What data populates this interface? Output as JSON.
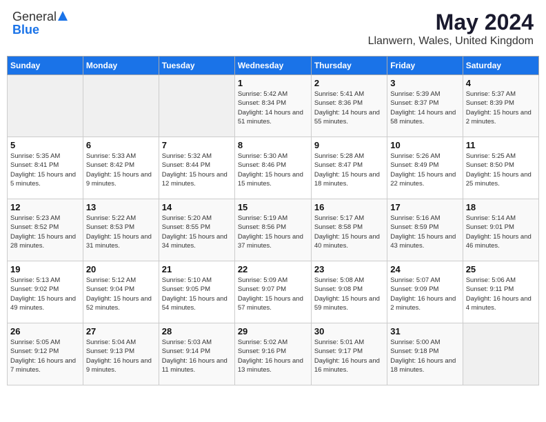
{
  "logo": {
    "general": "General",
    "blue": "Blue"
  },
  "title": {
    "month": "May 2024",
    "location": "Llanwern, Wales, United Kingdom"
  },
  "days_of_week": [
    "Sunday",
    "Monday",
    "Tuesday",
    "Wednesday",
    "Thursday",
    "Friday",
    "Saturday"
  ],
  "weeks": [
    [
      {
        "day": "",
        "info": ""
      },
      {
        "day": "",
        "info": ""
      },
      {
        "day": "",
        "info": ""
      },
      {
        "day": "1",
        "info": "Sunrise: 5:42 AM\nSunset: 8:34 PM\nDaylight: 14 hours and 51 minutes."
      },
      {
        "day": "2",
        "info": "Sunrise: 5:41 AM\nSunset: 8:36 PM\nDaylight: 14 hours and 55 minutes."
      },
      {
        "day": "3",
        "info": "Sunrise: 5:39 AM\nSunset: 8:37 PM\nDaylight: 14 hours and 58 minutes."
      },
      {
        "day": "4",
        "info": "Sunrise: 5:37 AM\nSunset: 8:39 PM\nDaylight: 15 hours and 2 minutes."
      }
    ],
    [
      {
        "day": "5",
        "info": "Sunrise: 5:35 AM\nSunset: 8:41 PM\nDaylight: 15 hours and 5 minutes."
      },
      {
        "day": "6",
        "info": "Sunrise: 5:33 AM\nSunset: 8:42 PM\nDaylight: 15 hours and 9 minutes."
      },
      {
        "day": "7",
        "info": "Sunrise: 5:32 AM\nSunset: 8:44 PM\nDaylight: 15 hours and 12 minutes."
      },
      {
        "day": "8",
        "info": "Sunrise: 5:30 AM\nSunset: 8:46 PM\nDaylight: 15 hours and 15 minutes."
      },
      {
        "day": "9",
        "info": "Sunrise: 5:28 AM\nSunset: 8:47 PM\nDaylight: 15 hours and 18 minutes."
      },
      {
        "day": "10",
        "info": "Sunrise: 5:26 AM\nSunset: 8:49 PM\nDaylight: 15 hours and 22 minutes."
      },
      {
        "day": "11",
        "info": "Sunrise: 5:25 AM\nSunset: 8:50 PM\nDaylight: 15 hours and 25 minutes."
      }
    ],
    [
      {
        "day": "12",
        "info": "Sunrise: 5:23 AM\nSunset: 8:52 PM\nDaylight: 15 hours and 28 minutes."
      },
      {
        "day": "13",
        "info": "Sunrise: 5:22 AM\nSunset: 8:53 PM\nDaylight: 15 hours and 31 minutes."
      },
      {
        "day": "14",
        "info": "Sunrise: 5:20 AM\nSunset: 8:55 PM\nDaylight: 15 hours and 34 minutes."
      },
      {
        "day": "15",
        "info": "Sunrise: 5:19 AM\nSunset: 8:56 PM\nDaylight: 15 hours and 37 minutes."
      },
      {
        "day": "16",
        "info": "Sunrise: 5:17 AM\nSunset: 8:58 PM\nDaylight: 15 hours and 40 minutes."
      },
      {
        "day": "17",
        "info": "Sunrise: 5:16 AM\nSunset: 8:59 PM\nDaylight: 15 hours and 43 minutes."
      },
      {
        "day": "18",
        "info": "Sunrise: 5:14 AM\nSunset: 9:01 PM\nDaylight: 15 hours and 46 minutes."
      }
    ],
    [
      {
        "day": "19",
        "info": "Sunrise: 5:13 AM\nSunset: 9:02 PM\nDaylight: 15 hours and 49 minutes."
      },
      {
        "day": "20",
        "info": "Sunrise: 5:12 AM\nSunset: 9:04 PM\nDaylight: 15 hours and 52 minutes."
      },
      {
        "day": "21",
        "info": "Sunrise: 5:10 AM\nSunset: 9:05 PM\nDaylight: 15 hours and 54 minutes."
      },
      {
        "day": "22",
        "info": "Sunrise: 5:09 AM\nSunset: 9:07 PM\nDaylight: 15 hours and 57 minutes."
      },
      {
        "day": "23",
        "info": "Sunrise: 5:08 AM\nSunset: 9:08 PM\nDaylight: 15 hours and 59 minutes."
      },
      {
        "day": "24",
        "info": "Sunrise: 5:07 AM\nSunset: 9:09 PM\nDaylight: 16 hours and 2 minutes."
      },
      {
        "day": "25",
        "info": "Sunrise: 5:06 AM\nSunset: 9:11 PM\nDaylight: 16 hours and 4 minutes."
      }
    ],
    [
      {
        "day": "26",
        "info": "Sunrise: 5:05 AM\nSunset: 9:12 PM\nDaylight: 16 hours and 7 minutes."
      },
      {
        "day": "27",
        "info": "Sunrise: 5:04 AM\nSunset: 9:13 PM\nDaylight: 16 hours and 9 minutes."
      },
      {
        "day": "28",
        "info": "Sunrise: 5:03 AM\nSunset: 9:14 PM\nDaylight: 16 hours and 11 minutes."
      },
      {
        "day": "29",
        "info": "Sunrise: 5:02 AM\nSunset: 9:16 PM\nDaylight: 16 hours and 13 minutes."
      },
      {
        "day": "30",
        "info": "Sunrise: 5:01 AM\nSunset: 9:17 PM\nDaylight: 16 hours and 16 minutes."
      },
      {
        "day": "31",
        "info": "Sunrise: 5:00 AM\nSunset: 9:18 PM\nDaylight: 16 hours and 18 minutes."
      },
      {
        "day": "",
        "info": ""
      }
    ]
  ]
}
